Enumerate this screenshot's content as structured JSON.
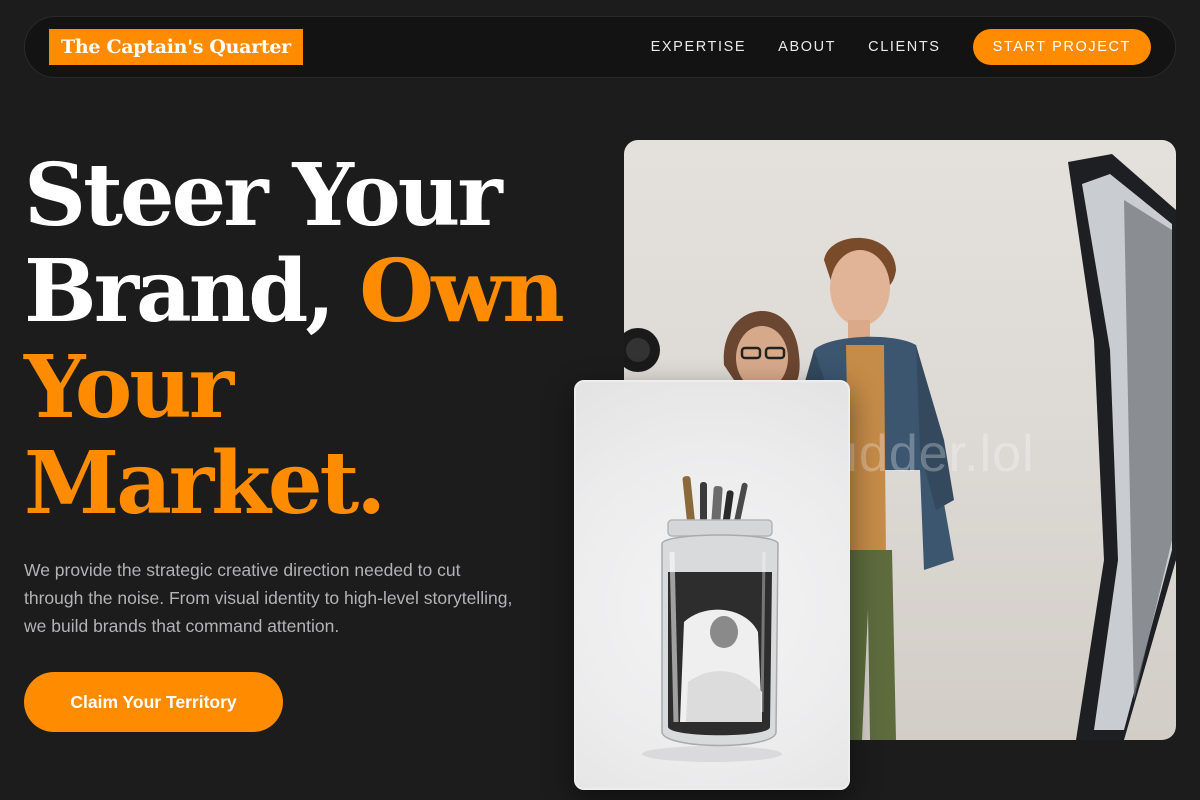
{
  "brand": {
    "name": "The Captain's Quarter",
    "accent_color": "#ff8c00"
  },
  "nav": {
    "links": [
      {
        "label": "EXPERTISE"
      },
      {
        "label": "ABOUT"
      },
      {
        "label": "CLIENTS"
      }
    ],
    "cta_label": "START PROJECT"
  },
  "hero": {
    "headline_line1": "Steer Your",
    "headline_line2_white": "Brand,",
    "headline_line2_accent": "Own",
    "headline_line3": "Your",
    "headline_line4": "Market.",
    "description": "We provide the strategic creative direction needed to cut through the noise. From visual identity to high-level storytelling, we build brands that command attention.",
    "cta_label": "Claim Your Territory"
  },
  "images": {
    "main_watermark": "udder.lol"
  }
}
